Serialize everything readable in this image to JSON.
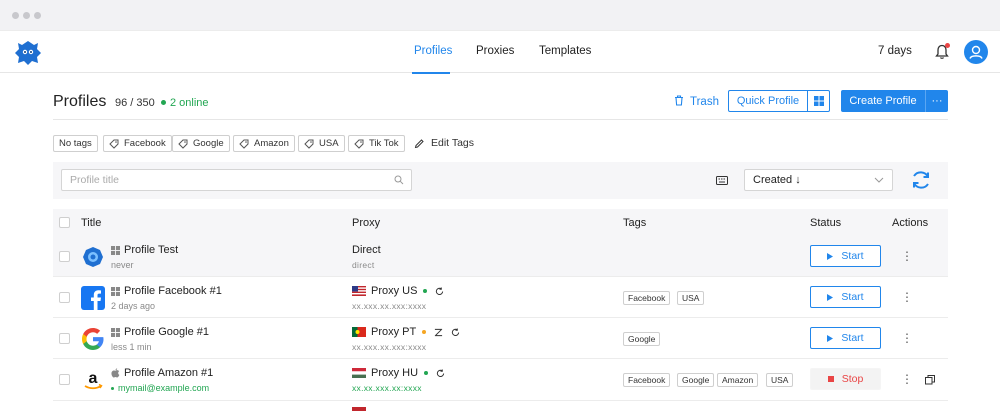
{
  "nav": {
    "tabs": [
      {
        "label": "Profiles"
      },
      {
        "label": "Proxies"
      },
      {
        "label": "Templates"
      }
    ],
    "days_left": "7 days"
  },
  "header": {
    "title": "Profiles",
    "count": "96 / 350",
    "online": "2 online",
    "trash_label": "Trash",
    "quick_profile_label": "Quick Profile",
    "create_profile_label": "Create Profile",
    "more_label": "···"
  },
  "tags": {
    "items": [
      "No tags",
      "Facebook",
      "Google",
      "Amazon",
      "USA",
      "Tik Tok"
    ],
    "edit_label": "Edit Tags"
  },
  "search": {
    "placeholder": "Profile title",
    "sort_value": "Created ↓"
  },
  "table": {
    "columns": [
      "Title",
      "Proxy",
      "Tags",
      "Status",
      "Actions"
    ],
    "rows": [
      {
        "icon": "browser-globe-icon",
        "os": "windows",
        "title": "Profile Test",
        "subtitle": "never",
        "proxy": "Direct",
        "proxy_sub": "direct",
        "tags": [],
        "status": "Start"
      },
      {
        "icon": "facebook-icon",
        "os": "windows",
        "title": "Profile Facebook #1",
        "subtitle": "2 days ago",
        "proxy": "Proxy US",
        "proxy_sub": "xx.xxx.xx.xxx:xxxx",
        "tags": [
          "Facebook",
          "USA"
        ],
        "status": "Start"
      },
      {
        "icon": "google-icon",
        "os": "windows",
        "title": "Profile Google #1",
        "subtitle": "less 1 min",
        "proxy": "Proxy PT",
        "proxy_sub": "xx.xxx.xx.xxx:xxxx",
        "tags": [
          "Google"
        ],
        "status": "Start"
      },
      {
        "icon": "amazon-icon",
        "os": "apple",
        "title": "Profile Amazon #1",
        "subtitle": "mymail@example.com",
        "proxy": "Proxy HU",
        "proxy_sub": "xx.xx.xxx.xx:xxxx",
        "tags": [
          "Facebook",
          "Google",
          "Amazon",
          "USA"
        ],
        "status": "Stop"
      }
    ]
  },
  "colors": {
    "accent": "#2186eb",
    "online": "#22a652",
    "warning": "#f5a623",
    "danger": "#e94545"
  }
}
